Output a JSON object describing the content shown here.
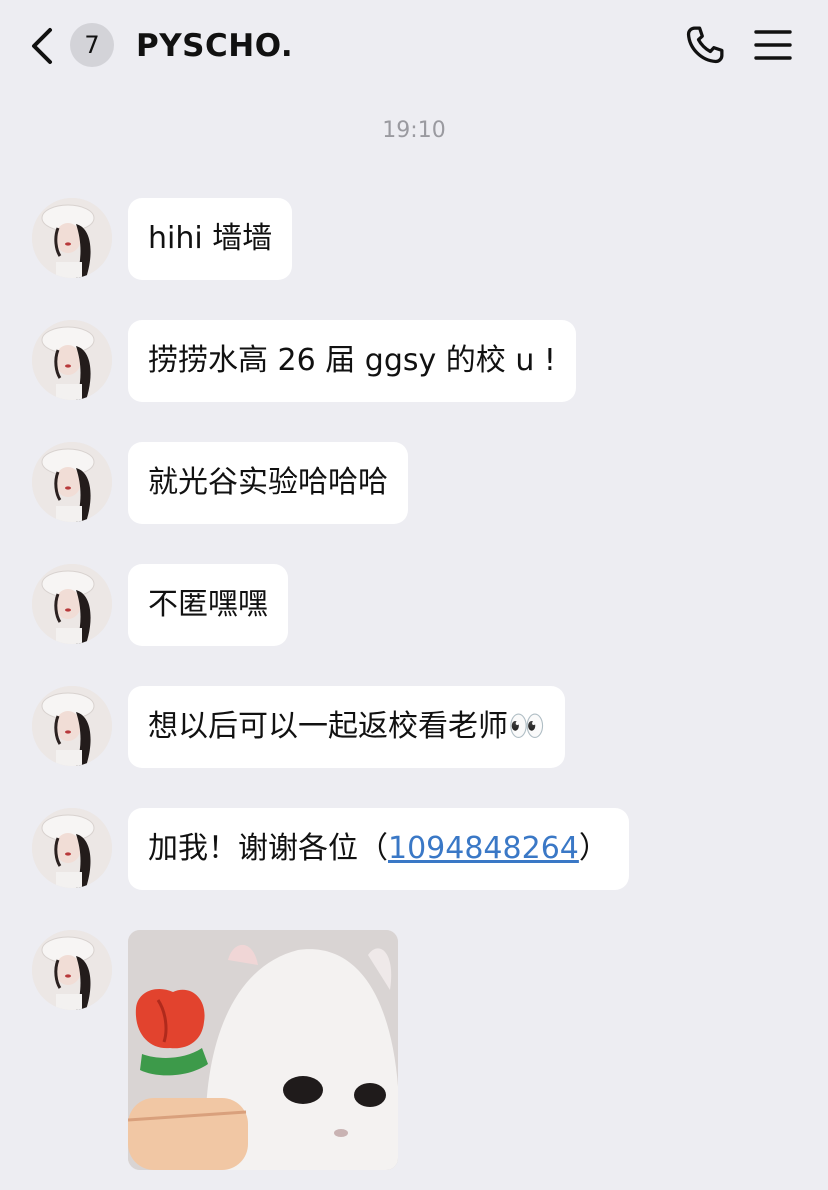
{
  "header": {
    "unread_count": "7",
    "title": "PYSCHO."
  },
  "timestamp": "19:10",
  "messages": [
    {
      "text": "hihi 墙墙"
    },
    {
      "text": "捞捞水高 26 届 ggsy 的校 u !"
    },
    {
      "text": "就光谷实验哈哈哈"
    },
    {
      "text": "不匿嘿嘿"
    },
    {
      "text": "想以后可以一起返校看老师👀"
    },
    {
      "prefix": "加我！谢谢各位（",
      "link": "1094848264",
      "suffix": "）"
    }
  ],
  "colors": {
    "background": "#ededf2",
    "bubble": "#ffffff",
    "link": "#3a78c6",
    "badge": "#d3d3d8"
  },
  "icons": [
    "back-chevron-icon",
    "phone-icon",
    "menu-icon"
  ]
}
